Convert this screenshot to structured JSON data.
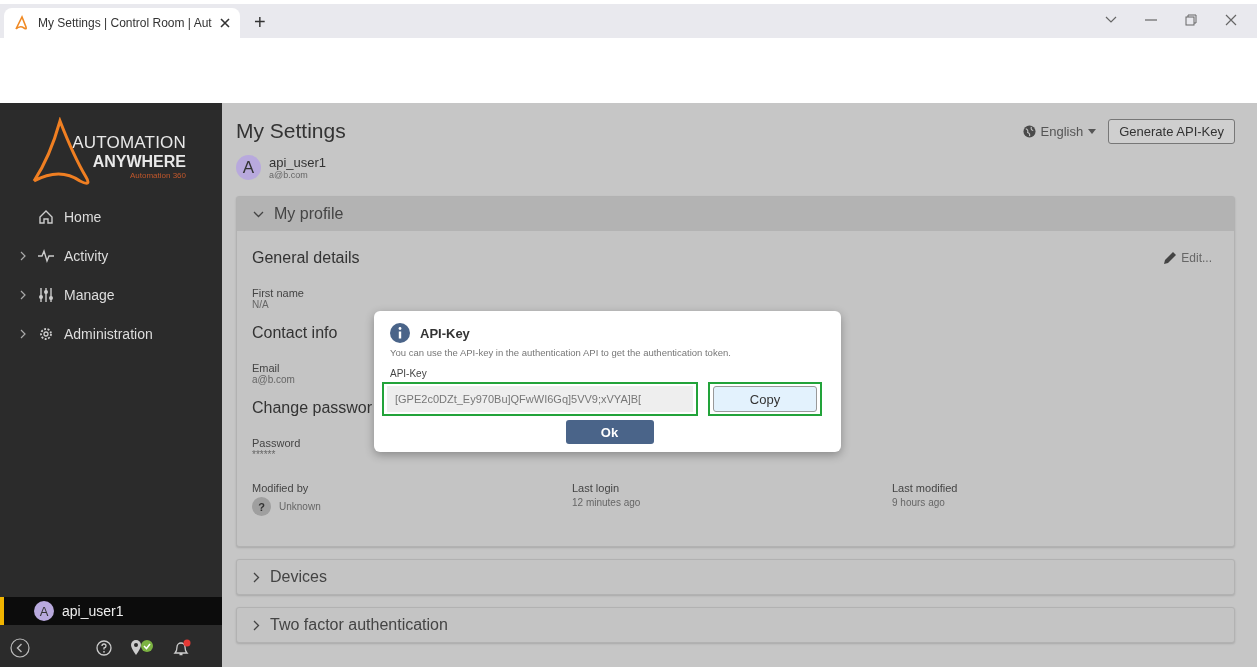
{
  "browser": {
    "tabs": [
      {
        "title": "My Settings | Control Room | Aut",
        "selected": true
      }
    ],
    "new_tab": "+"
  },
  "sidebar": {
    "logo": {
      "line1": "AUTOMATION",
      "line2": "ANYWHERE",
      "tagline": "Automation 360"
    },
    "items": [
      {
        "label": "Home",
        "kind": "home",
        "expandable": false
      },
      {
        "label": "Activity",
        "kind": "pulse",
        "expandable": true
      },
      {
        "label": "Manage",
        "kind": "sliders",
        "expandable": true
      },
      {
        "label": "Administration",
        "kind": "gear",
        "expandable": true
      }
    ],
    "user": {
      "initial": "A",
      "name": "api_user1",
      "selected": true
    }
  },
  "header": {
    "title": "My Settings",
    "language": "English",
    "generate_button": "Generate API-Key",
    "user": {
      "initial": "A",
      "name": "api_user1",
      "email": "a@b.com"
    }
  },
  "sections": [
    {
      "title": "My profile",
      "expanded": true
    },
    {
      "title": "Devices",
      "expanded": false
    },
    {
      "title": "Two factor authentication",
      "expanded": false
    }
  ],
  "profile": {
    "general_heading": "General details",
    "edit": "Edit...",
    "first_name_label": "First name",
    "first_name": "N/A",
    "contact_heading": "Contact info",
    "email_label": "Email",
    "email": "a@b.com",
    "password_heading": "Change passwor",
    "password_label": "Password",
    "password": "******",
    "meta": [
      {
        "label": "Modified by",
        "value": "Unknown",
        "avatar": "?"
      },
      {
        "label": "Last login",
        "value": "12 minutes ago"
      },
      {
        "label": "Last modified",
        "value": "9 hours ago"
      }
    ]
  },
  "dialog": {
    "title": "API-Key",
    "message": "You can use the API-key in the authentication API to get the authentication token.",
    "field_label": "API-Key",
    "field_value": "[GPE2c0DZt_Ey970Bu]QFwWI6Gq]5VV9;xVYA]B[",
    "field_highlighted": true,
    "copy_button": "Copy",
    "copy_highlighted": true,
    "ok_button": "Ok"
  }
}
